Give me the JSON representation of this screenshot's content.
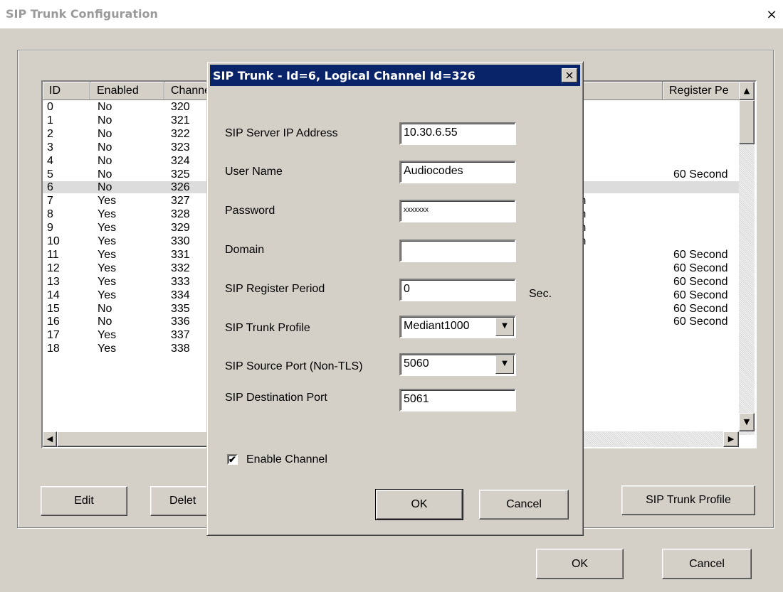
{
  "window": {
    "title": "SIP Trunk Configuration",
    "close_glyph": "×"
  },
  "list": {
    "columns": [
      "ID",
      "Enabled",
      "Channel",
      "Register Pe"
    ],
    "rows": [
      {
        "id": "0",
        "enabled": "No",
        "channel": "320",
        "right": "",
        "register": ""
      },
      {
        "id": "1",
        "enabled": "No",
        "channel": "321",
        "right": "",
        "register": ""
      },
      {
        "id": "2",
        "enabled": "No",
        "channel": "322",
        "right": "",
        "register": ""
      },
      {
        "id": "3",
        "enabled": "No",
        "channel": "323",
        "right": "",
        "register": ""
      },
      {
        "id": "4",
        "enabled": "No",
        "channel": "324",
        "right": "",
        "register": ""
      },
      {
        "id": "5",
        "enabled": "No",
        "channel": "325",
        "right": "",
        "register": "60 Second"
      },
      {
        "id": "6",
        "enabled": "No",
        "channel": "326",
        "right": "",
        "register": ""
      },
      {
        "id": "7",
        "enabled": "Yes",
        "channel": "327",
        "right": "m",
        "register": ""
      },
      {
        "id": "8",
        "enabled": "Yes",
        "channel": "328",
        "right": "m",
        "register": ""
      },
      {
        "id": "9",
        "enabled": "Yes",
        "channel": "329",
        "right": "m",
        "register": ""
      },
      {
        "id": "10",
        "enabled": "Yes",
        "channel": "330",
        "right": "m",
        "register": ""
      },
      {
        "id": "11",
        "enabled": "Yes",
        "channel": "331",
        "right": "",
        "register": "60 Second"
      },
      {
        "id": "12",
        "enabled": "Yes",
        "channel": "332",
        "right": "",
        "register": "60 Second"
      },
      {
        "id": "13",
        "enabled": "Yes",
        "channel": "333",
        "right": "",
        "register": "60 Second"
      },
      {
        "id": "14",
        "enabled": "Yes",
        "channel": "334",
        "right": "",
        "register": "60 Second"
      },
      {
        "id": "15",
        "enabled": "No",
        "channel": "335",
        "right": "",
        "register": "60 Second"
      },
      {
        "id": "16",
        "enabled": "No",
        "channel": "336",
        "right": "",
        "register": "60 Second"
      },
      {
        "id": "17",
        "enabled": "Yes",
        "channel": "337",
        "right": "",
        "register": ""
      },
      {
        "id": "18",
        "enabled": "Yes",
        "channel": "338",
        "right": "",
        "register": ""
      }
    ],
    "selected_index": 6
  },
  "buttons": {
    "edit": "Edit",
    "delete": "Delet",
    "sip_trunk_profile": "SIP Trunk Profile",
    "ok": "OK",
    "cancel": "Cancel"
  },
  "dialog": {
    "title": "SIP Trunk - Id=6, Logical Channel Id=326",
    "close_glyph": "×",
    "fields": {
      "server_ip": {
        "label": "SIP Server IP Address",
        "value": "10.30.6.55"
      },
      "user_name": {
        "label": "User Name",
        "value": "Audiocodes"
      },
      "password": {
        "label": "Password",
        "value": "xxxxxxx"
      },
      "domain": {
        "label": "Domain",
        "value": ""
      },
      "register_period": {
        "label": "SIP Register Period",
        "value": "0",
        "unit": "Sec."
      },
      "trunk_profile": {
        "label": "SIP Trunk Profile",
        "value": "Mediant1000"
      },
      "source_port": {
        "label": "SIP Source Port (Non-TLS)",
        "value": "5060"
      },
      "dest_port": {
        "label": "SIP Destination Port",
        "value": "5061"
      }
    },
    "enable_channel": {
      "label": "Enable Channel",
      "checked": true,
      "check_glyph": "✔"
    },
    "ok_label": "OK",
    "cancel_label": "Cancel"
  }
}
